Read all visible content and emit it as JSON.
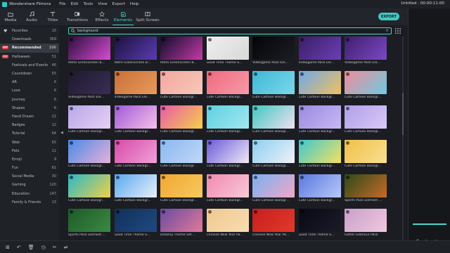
{
  "titlebar": {
    "app_name": "Wondershare Filmora",
    "menus": [
      "File",
      "Edit",
      "Tools",
      "View",
      "Export",
      "Help"
    ],
    "document": "Untitled : 00:00:11:00"
  },
  "toolbar": {
    "tabs": [
      {
        "label": "Media",
        "icon": "folder-icon"
      },
      {
        "label": "Audio",
        "icon": "music-icon"
      },
      {
        "label": "Titles",
        "icon": "text-icon"
      },
      {
        "label": "Transitions",
        "icon": "transition-icon"
      },
      {
        "label": "Effects",
        "icon": "effects-icon"
      },
      {
        "label": "Elements",
        "icon": "elements-icon"
      },
      {
        "label": "Split Screen",
        "icon": "split-screen-icon"
      }
    ],
    "active_tab": "Elements",
    "export_label": "EXPORT"
  },
  "colors": {
    "accent": "#49d6cf",
    "hot_badge": "#e14a4a"
  },
  "sidebar": {
    "items": [
      {
        "label": "Favorites",
        "count": "15"
      },
      {
        "label": "Downloads",
        "count": "369"
      },
      {
        "label": "Recommended",
        "count": "106",
        "badge": "HOT"
      },
      {
        "label": "Halloween",
        "count": "51",
        "badge": "HOT"
      },
      {
        "label": "Festivals and Events",
        "count": "46"
      },
      {
        "label": "Countdown",
        "count": "55"
      },
      {
        "label": "AR",
        "count": "6"
      },
      {
        "label": "Love",
        "count": "6"
      },
      {
        "label": "Journey",
        "count": "6"
      },
      {
        "label": "Shapes",
        "count": "6"
      },
      {
        "label": "Hand Drawn",
        "count": "21"
      },
      {
        "label": "Badges",
        "count": "12"
      },
      {
        "label": "Tutorial",
        "count": "64"
      },
      {
        "label": "Web",
        "count": "55"
      },
      {
        "label": "Pets",
        "count": "11"
      },
      {
        "label": "Emoji",
        "count": "9"
      },
      {
        "label": "Fun",
        "count": "61"
      },
      {
        "label": "Social Media",
        "count": "30"
      },
      {
        "label": "Gaming",
        "count": "120"
      },
      {
        "label": "Education",
        "count": "147"
      },
      {
        "label": "Family & Friends",
        "count": "13"
      }
    ]
  },
  "search": {
    "value": "background"
  },
  "grid": {
    "items": [
      {
        "caption": "Retro Greenscreen B...",
        "c1": "#2a0f3a",
        "c2": "#d84bd4"
      },
      {
        "caption": "Retro Greenscreen B...",
        "c1": "#1c1240",
        "c2": "#5a3cb0"
      },
      {
        "caption": "Retro Greenscreen B...",
        "c1": "#0e0d2a",
        "c2": "#c53aa8"
      },
      {
        "caption": "Good Time Theme S...",
        "c1": "#eeeeee",
        "c2": "#d8d8d8"
      },
      {
        "caption": "Videogame Pack Ele...",
        "c1": "#050608",
        "c2": "#1c1c24"
      },
      {
        "caption": "Videogame Pack Ele...",
        "c1": "#3a1e66",
        "c2": "#6b3fb4"
      },
      {
        "caption": "Videogame Pack Ele...",
        "c1": "#3f1f6e",
        "c2": "#7b48c4"
      },
      {
        "caption": "Videogame Pack Ele...",
        "c1": "#1f1a2e",
        "c2": "#3a2d55"
      },
      {
        "caption": "Videogame Pack Ele...",
        "c1": "#c8703a",
        "c2": "#e89a5a"
      },
      {
        "caption": "Cute Cartoon Backgr...",
        "c1": "#f3a7a0",
        "c2": "#f6c8b8"
      },
      {
        "caption": "Cute Cartoon Backgr...",
        "c1": "#f06a7e",
        "c2": "#f59aa8"
      },
      {
        "caption": "Cute Cartoon Backgr...",
        "c1": "#3fb8d6",
        "c2": "#7ad8ea"
      },
      {
        "caption": "Cute Cartoon Backgr...",
        "c1": "#6fa8e8",
        "c2": "#f0c060"
      },
      {
        "caption": "Cute Cartoon Backgr...",
        "c1": "#f28a9a",
        "c2": "#6ecbe0"
      },
      {
        "caption": "Cute Cartoon Backgr...",
        "c1": "#b6a8e8",
        "c2": "#e8d0f4"
      },
      {
        "caption": "Cute Cartoon Backgr...",
        "c1": "#a05ad8",
        "c2": "#f4c0e8"
      },
      {
        "caption": "Cute Cartoon Backgr...",
        "c1": "#e85aa8",
        "c2": "#f6d04a"
      },
      {
        "caption": "Cute Cartoon Backgr...",
        "c1": "#5fd0e0",
        "c2": "#a0e8f0"
      },
      {
        "caption": "Cute Cartoon Backgr...",
        "c1": "#3fc8c0",
        "c2": "#f0e0f0"
      },
      {
        "caption": "Cute Cartoon Backgr...",
        "c1": "#9a8ae0",
        "c2": "#c8b8f4"
      },
      {
        "caption": "Cute Cartoon Backgr...",
        "c1": "#b0a0e8",
        "c2": "#d8c8f8"
      },
      {
        "caption": "Cute Cartoon Backgr...",
        "c1": "#4a8ae8",
        "c2": "#e8b0d8"
      },
      {
        "caption": "Cute Cartoon Backgr...",
        "c1": "#d84aa8",
        "c2": "#f0a0d8"
      },
      {
        "caption": "Cute Cartoon Backgr...",
        "c1": "#8ab8f0",
        "c2": "#c0d8f8"
      },
      {
        "caption": "Cute Cartoon Backgr...",
        "c1": "#6a5ad8",
        "c2": "#f0e8f8"
      },
      {
        "caption": "Cute Cartoon Backgr...",
        "c1": "#8ad0f0",
        "c2": "#f0f0f8"
      },
      {
        "caption": "Cute Cartoon Backgr...",
        "c1": "#3fc8d0",
        "c2": "#f4e060"
      },
      {
        "caption": "Cute Cartoon Backgr...",
        "c1": "#f0c048",
        "c2": "#f8e090"
      },
      {
        "caption": "Cute Cartoon Backgr...",
        "c1": "#2ab8c8",
        "c2": "#f0d048"
      },
      {
        "caption": "Cute Cartoon Backgr...",
        "c1": "#5aa8f0",
        "c2": "#e8f0f8"
      },
      {
        "caption": "Cute Cartoon Backgr...",
        "c1": "#f0a830",
        "c2": "#f8c860"
      },
      {
        "caption": "Cute Cartoon Backgr...",
        "c1": "#f08ab0",
        "c2": "#f8c8d8"
      },
      {
        "caption": "Cute Cartoon Backgr...",
        "c1": "#7ab0f0",
        "c2": "#f0a8c8"
      },
      {
        "caption": "Cute Cartoon Backgr...",
        "c1": "#5a78e0",
        "c2": "#b8c8f8"
      },
      {
        "caption": "Sports Pack Element ...",
        "c1": "#2a4a1a",
        "c2": "#c86a28"
      },
      {
        "caption": "Sports Pack Element ...",
        "c1": "#1e5a2a",
        "c2": "#3a8a40"
      },
      {
        "caption": "Good Time Theme S...",
        "c1": "#12305a",
        "c2": "#1e4a80"
      },
      {
        "caption": "Dreamy Theme Set ...",
        "c1": "#6a4aa0",
        "c2": "#e07a9a"
      },
      {
        "caption": "Chinese New Year Pa...",
        "c1": "#f0c890",
        "c2": "#f8dcb0"
      },
      {
        "caption": "Chinese New Year Pa...",
        "c1": "#c81e1e",
        "c2": "#e03a2a"
      },
      {
        "caption": "Good Time Theme S...",
        "c1": "#0a0a14",
        "c2": "#1a1a2a"
      },
      {
        "caption": "Glitter Glamour Pack",
        "c1": "#c8a0c8",
        "c2": "#f0c8e0"
      }
    ]
  },
  "preview": {
    "play_icons": [
      "prev-frame-icon",
      "play-icon",
      "next-frame-icon"
    ]
  },
  "bottombar": {
    "icons": [
      "add-track-icon",
      "undo-icon",
      "delete-icon",
      "clock-icon",
      "split-icon",
      "audio-icon"
    ]
  }
}
